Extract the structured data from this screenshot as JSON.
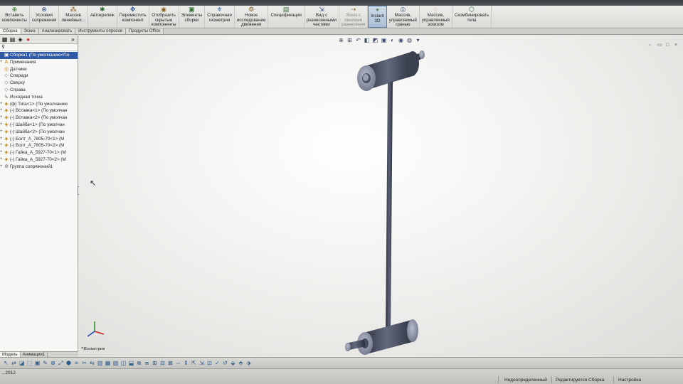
{
  "ribbon": {
    "buttons": [
      {
        "label": "Вставить\nкомпоненты",
        "icon": "insert-component-icon"
      },
      {
        "label": "Условия\nсопряжения",
        "icon": "mate-icon"
      },
      {
        "label": "Массив\nлинейных...",
        "icon": "linear-pattern-icon"
      },
      {
        "label": "Автокрепеж",
        "icon": "smart-fasteners-icon"
      },
      {
        "label": "Переместить\nкомпонент",
        "icon": "move-component-icon"
      },
      {
        "label": "Отобразить\nскрытые\nкомпоненты",
        "icon": "show-hidden-icon"
      },
      {
        "label": "Элементы\nсборки",
        "icon": "assembly-features-icon"
      },
      {
        "label": "Справочная\nгеометрия",
        "icon": "reference-geometry-icon"
      },
      {
        "label": "Новое\nисследование\nдвижения",
        "icon": "motion-study-icon"
      },
      {
        "label": "Спецификация",
        "icon": "bom-icon"
      },
      {
        "label": "Вид с\nразнесенными\nчастями",
        "icon": "exploded-view-icon"
      },
      {
        "label": "Эскиз с\nлиниями\nразнесения",
        "icon": "explode-line-sketch-icon"
      },
      {
        "label": "Instant\n3D",
        "icon": "instant3d-icon"
      },
      {
        "label": "Массив,\nуправляемый\nгранью",
        "icon": "pattern-driven-face-icon"
      },
      {
        "label": "Массив,\nуправляемый\nэскизом",
        "icon": "pattern-driven-sketch-icon"
      },
      {
        "label": "Скомбинировать\nтела",
        "icon": "combine-bodies-icon"
      }
    ]
  },
  "tabs": [
    "Сборка",
    "Эскиз",
    "Анализировать",
    "Инструменты опросов",
    "Продукты Office"
  ],
  "tree": {
    "filter_icon": "filter-icon",
    "items": [
      {
        "label": "Сборка1 (По умолчанию<По",
        "icon": "assembly-icon",
        "root": true
      },
      {
        "label": "Примечания",
        "icon": "annotations-icon"
      },
      {
        "label": "Датчики",
        "icon": "sensors-icon"
      },
      {
        "label": "Спереди",
        "icon": "plane-icon"
      },
      {
        "label": "Сверху",
        "icon": "plane-icon"
      },
      {
        "label": "Справа",
        "icon": "plane-icon"
      },
      {
        "label": "Исходная точка",
        "icon": "origin-icon"
      },
      {
        "label": "(ф) Тяга<1> (По умолчанию",
        "icon": "part-icon"
      },
      {
        "label": "(-) Вставка<1> (По умолчан",
        "icon": "part-icon"
      },
      {
        "label": "(-) Вставка<2> (По умолчан",
        "icon": "part-icon"
      },
      {
        "label": "(-) Шайба<1> (По умолчан",
        "icon": "part-icon"
      },
      {
        "label": "(-) Шайба<2> (По умолчан",
        "icon": "part-icon"
      },
      {
        "label": "(-) Болт_А_7805-70<1> (М",
        "icon": "part-icon"
      },
      {
        "label": "(-) Болт_А_7805-70<2> (М",
        "icon": "part-icon"
      },
      {
        "label": "(-) Гайка_А_5927-70<1> (М",
        "icon": "part-icon"
      },
      {
        "label": "(-) Гайка_А_5927-70<2> (М",
        "icon": "part-icon"
      },
      {
        "label": "Группа сопряжений1",
        "icon": "mates-group-icon"
      }
    ]
  },
  "left_tabs": [
    "Модель",
    "Анимация1"
  ],
  "viewport": {
    "view_label": "*Изометрия"
  },
  "status": {
    "left": "...2012",
    "underdefined": "Недоопределенный",
    "editing": "Редактируется Сборка",
    "settings": "Настройка"
  },
  "colors": {
    "accent": "#2f5aa5",
    "part_body": "#3e4453",
    "part_highlight": "#8d93a6"
  }
}
